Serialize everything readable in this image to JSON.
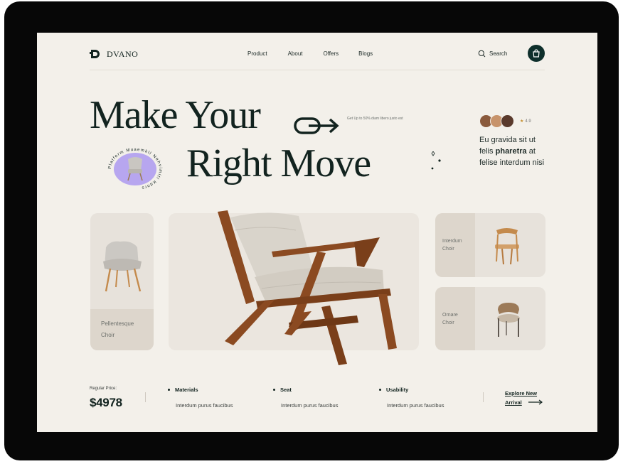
{
  "header": {
    "logo_text": "DVANO",
    "nav": [
      "Product",
      "About",
      "Offers",
      "Blogs"
    ],
    "search_label": "Search"
  },
  "hero": {
    "line1": "Make Your",
    "line2": "Right Move",
    "promo": "Get Up to 50% diam libero justo est",
    "badge_text": "Platform Muaemkll Nehvimiti Kdnrs",
    "rating": "4.9",
    "side_text_pre": "Eu gravida sit ut felis ",
    "side_text_bold": "pharetra",
    "side_text_post": " at felise interdum nisi"
  },
  "products": {
    "left_label_1": "Pellentesque",
    "left_label_2": "Choir",
    "tr_label_1": "Interdum",
    "tr_label_2": "Choir",
    "br_label_1": "Ornare",
    "br_label_2": "Choir"
  },
  "footer": {
    "price_label": "Regular Price:",
    "price": "$4978",
    "features": [
      {
        "title": "Materials",
        "desc": "Interdum purus faucibus"
      },
      {
        "title": "Seat",
        "desc": "Interdum purus faucibus"
      },
      {
        "title": "Usability",
        "desc": "Interdum purus faucibus"
      }
    ],
    "explore_line1": "Explore New",
    "explore_line2": "Arrival"
  },
  "colors": {
    "background": "#f3f0ea",
    "dark": "#12231f",
    "card": "#e7e2db",
    "badge": "#b7a6ef",
    "wood": "#8b4a21"
  },
  "icons": [
    "logo-icon",
    "search-icon",
    "bag-icon",
    "arrow-right-icon",
    "sparkle-icon",
    "star-icon"
  ]
}
